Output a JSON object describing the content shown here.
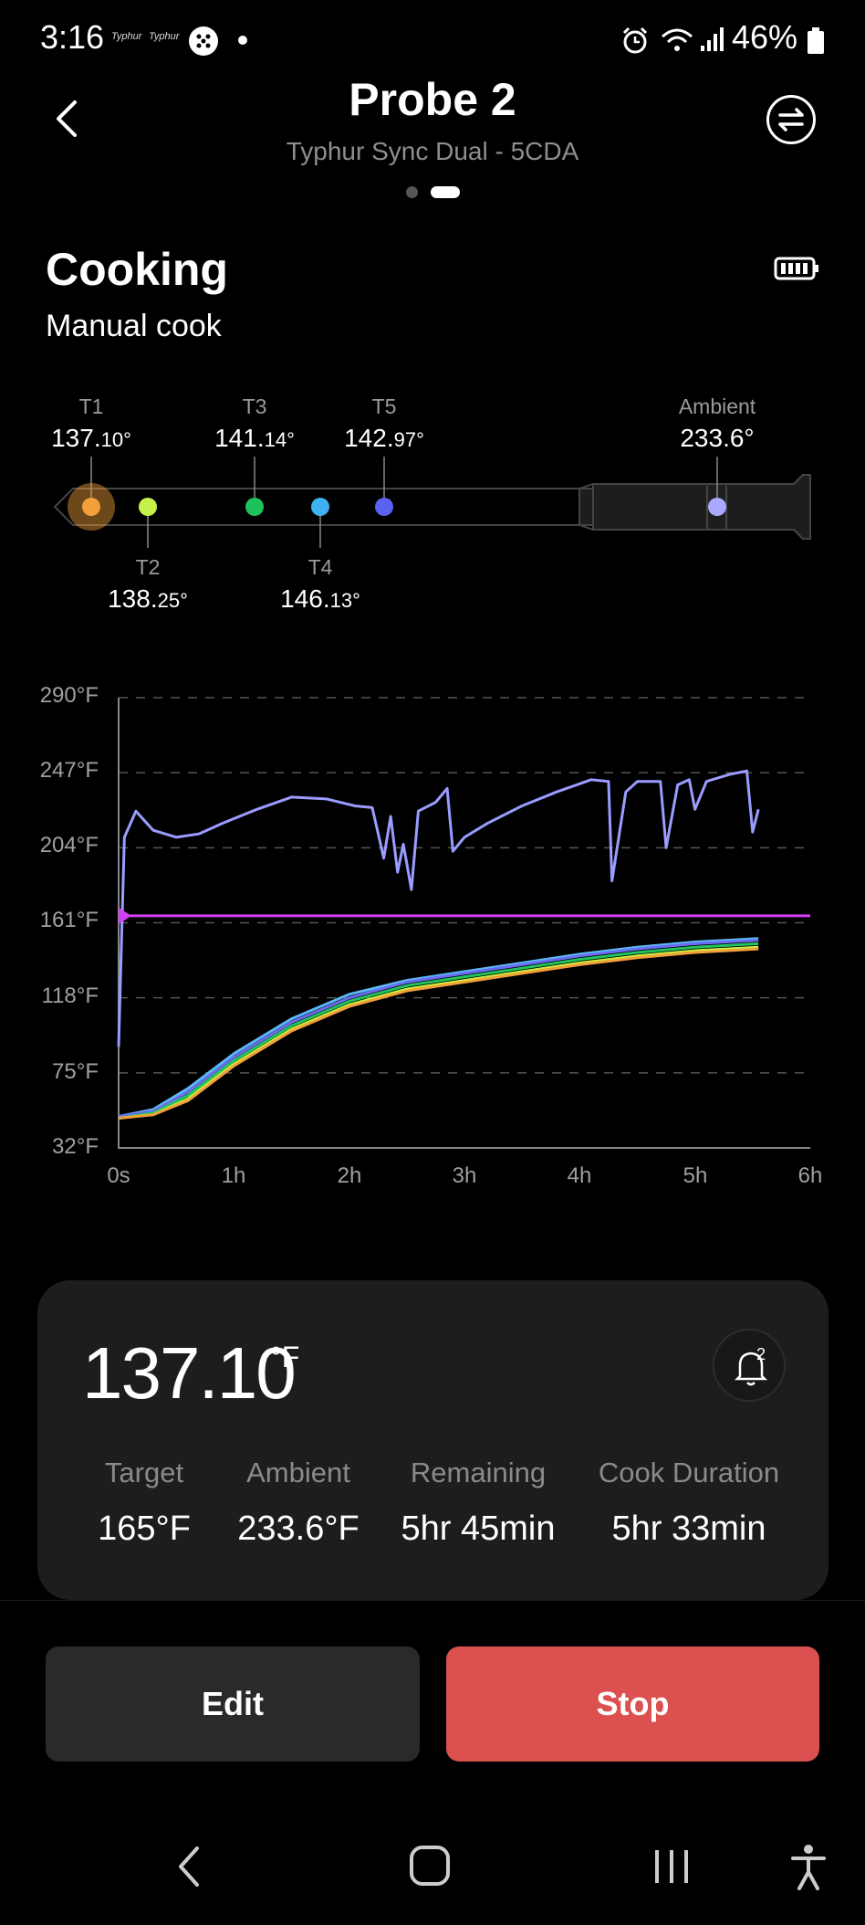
{
  "status_bar": {
    "time": "3:16",
    "brand_a": "Typhur",
    "brand_b": "Typhur",
    "battery_pct": "46%"
  },
  "header": {
    "title": "Probe 2",
    "subtitle": "Typhur Sync Dual - 5CDA"
  },
  "section": {
    "title": "Cooking",
    "mode": "Manual cook"
  },
  "probe": {
    "sensors": [
      {
        "label": "T1",
        "int": "137.",
        "dec": "10°",
        "color": "#f2a03a"
      },
      {
        "label": "T2",
        "int": "138.",
        "dec": "25°",
        "color": "#c6f04a"
      },
      {
        "label": "T3",
        "int": "141.",
        "dec": "14°",
        "color": "#1ec25a"
      },
      {
        "label": "T4",
        "int": "146.",
        "dec": "13°",
        "color": "#3fb0f0"
      },
      {
        "label": "T5",
        "int": "142.",
        "dec": "97°",
        "color": "#5a62f0"
      },
      {
        "label": "Ambient",
        "int": "233.6°",
        "dec": "",
        "color": "#a8a8ff"
      }
    ]
  },
  "chart_data": {
    "type": "line",
    "y_ticks": [
      "290°F",
      "247°F",
      "204°F",
      "161°F",
      "118°F",
      "75°F",
      "32°F"
    ],
    "x_ticks": [
      "0s",
      "1h",
      "2h",
      "3h",
      "4h",
      "5h",
      "6h"
    ],
    "ylim": [
      32,
      290
    ],
    "xlim_hours": [
      0,
      6
    ],
    "target_line": 165,
    "series": [
      {
        "color": "#9a9cff",
        "points": [
          [
            0,
            90
          ],
          [
            0.05,
            210
          ],
          [
            0.15,
            225
          ],
          [
            0.3,
            214
          ],
          [
            0.5,
            210
          ],
          [
            0.7,
            212
          ],
          [
            0.9,
            218
          ],
          [
            1.2,
            226
          ],
          [
            1.5,
            233
          ],
          [
            1.8,
            232
          ],
          [
            2.05,
            228
          ],
          [
            2.2,
            227
          ],
          [
            2.3,
            198
          ],
          [
            2.36,
            222
          ],
          [
            2.42,
            190
          ],
          [
            2.47,
            206
          ],
          [
            2.54,
            180
          ],
          [
            2.6,
            225
          ],
          [
            2.75,
            230
          ],
          [
            2.85,
            238
          ],
          [
            2.9,
            202
          ],
          [
            3.0,
            210
          ],
          [
            3.2,
            218
          ],
          [
            3.5,
            228
          ],
          [
            3.8,
            236
          ],
          [
            4.1,
            243
          ],
          [
            4.25,
            242
          ],
          [
            4.28,
            185
          ],
          [
            4.4,
            236
          ],
          [
            4.5,
            242
          ],
          [
            4.7,
            242
          ],
          [
            4.75,
            204
          ],
          [
            4.85,
            240
          ],
          [
            4.95,
            243
          ],
          [
            5.0,
            226
          ],
          [
            5.1,
            242
          ],
          [
            5.3,
            246
          ],
          [
            5.45,
            248
          ],
          [
            5.5,
            213
          ],
          [
            5.55,
            226
          ]
        ]
      },
      {
        "color": "#5bb8f5",
        "points": [
          [
            0,
            50
          ],
          [
            0.3,
            54
          ],
          [
            0.6,
            66
          ],
          [
            1.0,
            86
          ],
          [
            1.5,
            106
          ],
          [
            2.0,
            120
          ],
          [
            2.5,
            128
          ],
          [
            3.0,
            133
          ],
          [
            3.5,
            138
          ],
          [
            4.0,
            143
          ],
          [
            4.5,
            147
          ],
          [
            5.0,
            150
          ],
          [
            5.55,
            152
          ]
        ]
      },
      {
        "color": "#6a6cf2",
        "points": [
          [
            0,
            50
          ],
          [
            0.3,
            53
          ],
          [
            0.6,
            64
          ],
          [
            1.0,
            84
          ],
          [
            1.5,
            104
          ],
          [
            2.0,
            118
          ],
          [
            2.5,
            127
          ],
          [
            3.0,
            132
          ],
          [
            3.5,
            137
          ],
          [
            4.0,
            142
          ],
          [
            4.5,
            146
          ],
          [
            5.0,
            149
          ],
          [
            5.55,
            151
          ]
        ]
      },
      {
        "color": "#22c45e",
        "points": [
          [
            0,
            49
          ],
          [
            0.3,
            52
          ],
          [
            0.6,
            62
          ],
          [
            1.0,
            82
          ],
          [
            1.5,
            102
          ],
          [
            2.0,
            116
          ],
          [
            2.5,
            125
          ],
          [
            3.0,
            130
          ],
          [
            3.5,
            135
          ],
          [
            4.0,
            140
          ],
          [
            4.5,
            144
          ],
          [
            5.0,
            147
          ],
          [
            5.55,
            149
          ]
        ]
      },
      {
        "color": "#c8f040",
        "points": [
          [
            0,
            49
          ],
          [
            0.3,
            51
          ],
          [
            0.6,
            60
          ],
          [
            1.0,
            80
          ],
          [
            1.5,
            100
          ],
          [
            2.0,
            114
          ],
          [
            2.5,
            123
          ],
          [
            3.0,
            128
          ],
          [
            3.5,
            133
          ],
          [
            4.0,
            138
          ],
          [
            4.5,
            142
          ],
          [
            5.0,
            145
          ],
          [
            5.55,
            147
          ]
        ]
      },
      {
        "color": "#f2a03a",
        "points": [
          [
            0,
            49
          ],
          [
            0.3,
            51
          ],
          [
            0.6,
            59
          ],
          [
            1.0,
            79
          ],
          [
            1.5,
            99
          ],
          [
            2.0,
            113
          ],
          [
            2.5,
            122
          ],
          [
            3.0,
            127
          ],
          [
            3.5,
            132
          ],
          [
            4.0,
            137
          ],
          [
            4.5,
            141
          ],
          [
            5.0,
            144
          ],
          [
            5.55,
            146
          ]
        ]
      }
    ]
  },
  "card": {
    "temp": "137.10",
    "unit": "°F",
    "bell_count": "2",
    "stats": [
      {
        "label": "Target",
        "value": "165°F"
      },
      {
        "label": "Ambient",
        "value": "233.6°F"
      },
      {
        "label": "Remaining",
        "value": "5hr 45min"
      },
      {
        "label": "Cook Duration",
        "value": "5hr 33min"
      }
    ]
  },
  "buttons": {
    "edit": "Edit",
    "stop": "Stop"
  }
}
